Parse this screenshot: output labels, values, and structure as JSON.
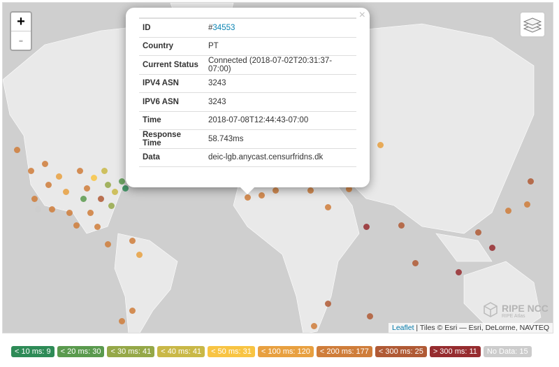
{
  "map": {
    "zoom_in": "+",
    "zoom_out": "-",
    "layers_icon": "layers-icon",
    "attribution": {
      "link": "Leaflet",
      "text": " | Tiles © Esri — Esri, DeLorme, NAVTEQ"
    },
    "watermark": {
      "title": "RIPE NCC",
      "subtitle": "RIPE Atlas"
    }
  },
  "popup": {
    "close": "×",
    "rows": [
      {
        "label": "ID",
        "prefix": "#",
        "value": "34553"
      },
      {
        "label": "Country",
        "value": "PT"
      },
      {
        "label": "Current Status",
        "value": "Connected (2018-07-02T20:31:37-07:00)"
      },
      {
        "label": "IPV4 ASN",
        "value": "3243"
      },
      {
        "label": "IPV6 ASN",
        "value": "3243"
      },
      {
        "label": "Time",
        "value": "2018-07-08T12:44:43-07:00"
      },
      {
        "label": "Response Time",
        "value": "58.743ms"
      },
      {
        "label": "Data",
        "value": "deic-lgb.anycast.censurfridns.dk"
      }
    ]
  },
  "legend": [
    {
      "label": "< 10 ms: 9",
      "color": "#2e8b57"
    },
    {
      "label": "< 20 ms: 30",
      "color": "#5a9a4e"
    },
    {
      "label": "< 30 ms: 41",
      "color": "#95a848"
    },
    {
      "label": "< 40 ms: 41",
      "color": "#c9b847"
    },
    {
      "label": "< 50 ms: 31",
      "color": "#f8c443"
    },
    {
      "label": "< 100 ms: 120",
      "color": "#e8a040"
    },
    {
      "label": "< 200 ms: 177",
      "color": "#cf7d3a"
    },
    {
      "label": "< 300 ms: 25",
      "color": "#b05a35"
    },
    {
      "label": "> 300 ms: 11",
      "color": "#962c2f"
    },
    {
      "label": "No Data: 15",
      "color": "#cccccc"
    }
  ]
}
